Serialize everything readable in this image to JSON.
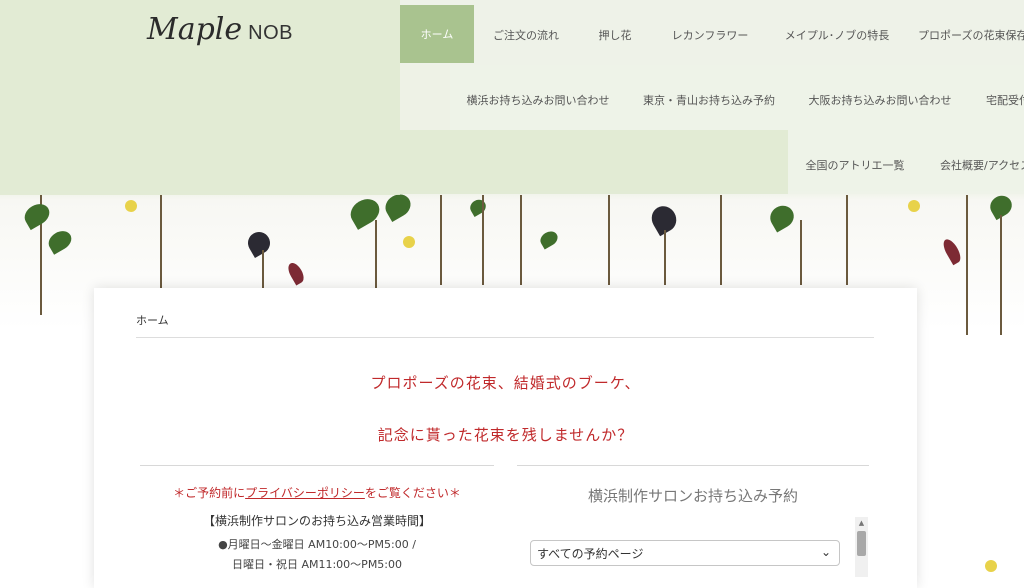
{
  "logo": {
    "script": "Maple",
    "brand": "NOB"
  },
  "nav": {
    "row1": [
      "ホーム",
      "ご注文の流れ",
      "押し花",
      "レカンフラワー",
      "メイプル･ノブの特長",
      "プロポーズの花束保存"
    ],
    "row2": [
      "横浜お持ち込みお問い合わせ",
      "東京・青山お持ち込み予約",
      "大阪お持ち込みお問い合わせ",
      "宅配受付"
    ],
    "row3": [
      "全国のアトリエ一覧",
      "会社概要/アクセス"
    ]
  },
  "breadcrumb": "ホーム",
  "headline": {
    "line1": "プロポーズの花束、結婚式のブーケ、",
    "line2": "記念に貰った花束を残しませんか？"
  },
  "notice": {
    "prefix": "＊ご予約前に",
    "link": "プライバシーポリシー",
    "suffix": "をご覧ください＊"
  },
  "hours": {
    "title": "【横浜制作サロンのお持ち込み営業時間】",
    "line1": "●月曜日～金曜日 AM10:00～PM5:00 /",
    "line2": "日曜日・祝日 AM11:00～PM5:00"
  },
  "booking": {
    "title": "横浜制作サロンお持ち込み予約",
    "select_value": "すべての予約ページ"
  },
  "colors": {
    "accent": "#a9c38f",
    "headline": "#c0292b"
  }
}
